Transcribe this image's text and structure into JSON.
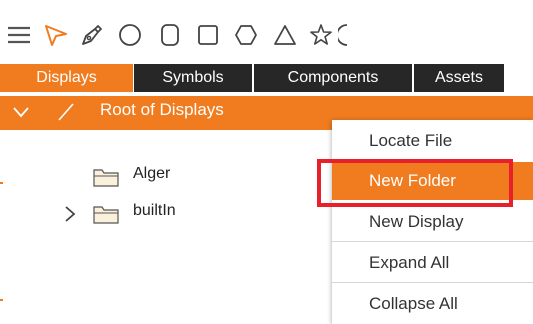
{
  "toolbar": {
    "tools": [
      {
        "icon": "hamburger-menu-icon"
      },
      {
        "icon": "pointer-arrow-icon",
        "color": "#f07c1f"
      },
      {
        "icon": "pen-tool-icon"
      },
      {
        "icon": "circle-icon"
      },
      {
        "icon": "rounded-rectangle-icon"
      },
      {
        "icon": "rectangle-icon"
      },
      {
        "icon": "hexagon-icon"
      },
      {
        "icon": "triangle-icon"
      },
      {
        "icon": "star-icon"
      }
    ]
  },
  "tabs": {
    "items": [
      {
        "label": "Displays",
        "active": true
      },
      {
        "label": "Symbols",
        "active": false
      },
      {
        "label": "Components",
        "active": false
      },
      {
        "label": "Assets",
        "active": false
      }
    ]
  },
  "tree": {
    "root_label": "Root of Displays",
    "items": [
      {
        "label": "Alger",
        "expandable": false
      },
      {
        "label": "builtIn",
        "expandable": true
      }
    ]
  },
  "context_menu": {
    "items": [
      {
        "label": "Locate File",
        "highlighted": false
      },
      {
        "label": "New Folder",
        "highlighted": true
      },
      {
        "label": "New Display",
        "highlighted": false
      },
      {
        "label": "Expand All",
        "highlighted": false
      },
      {
        "label": "Collapse All",
        "highlighted": false
      }
    ]
  },
  "colors": {
    "accent": "#f07c1f",
    "tab_dark": "#272727",
    "annotation_red": "#e8202b"
  }
}
